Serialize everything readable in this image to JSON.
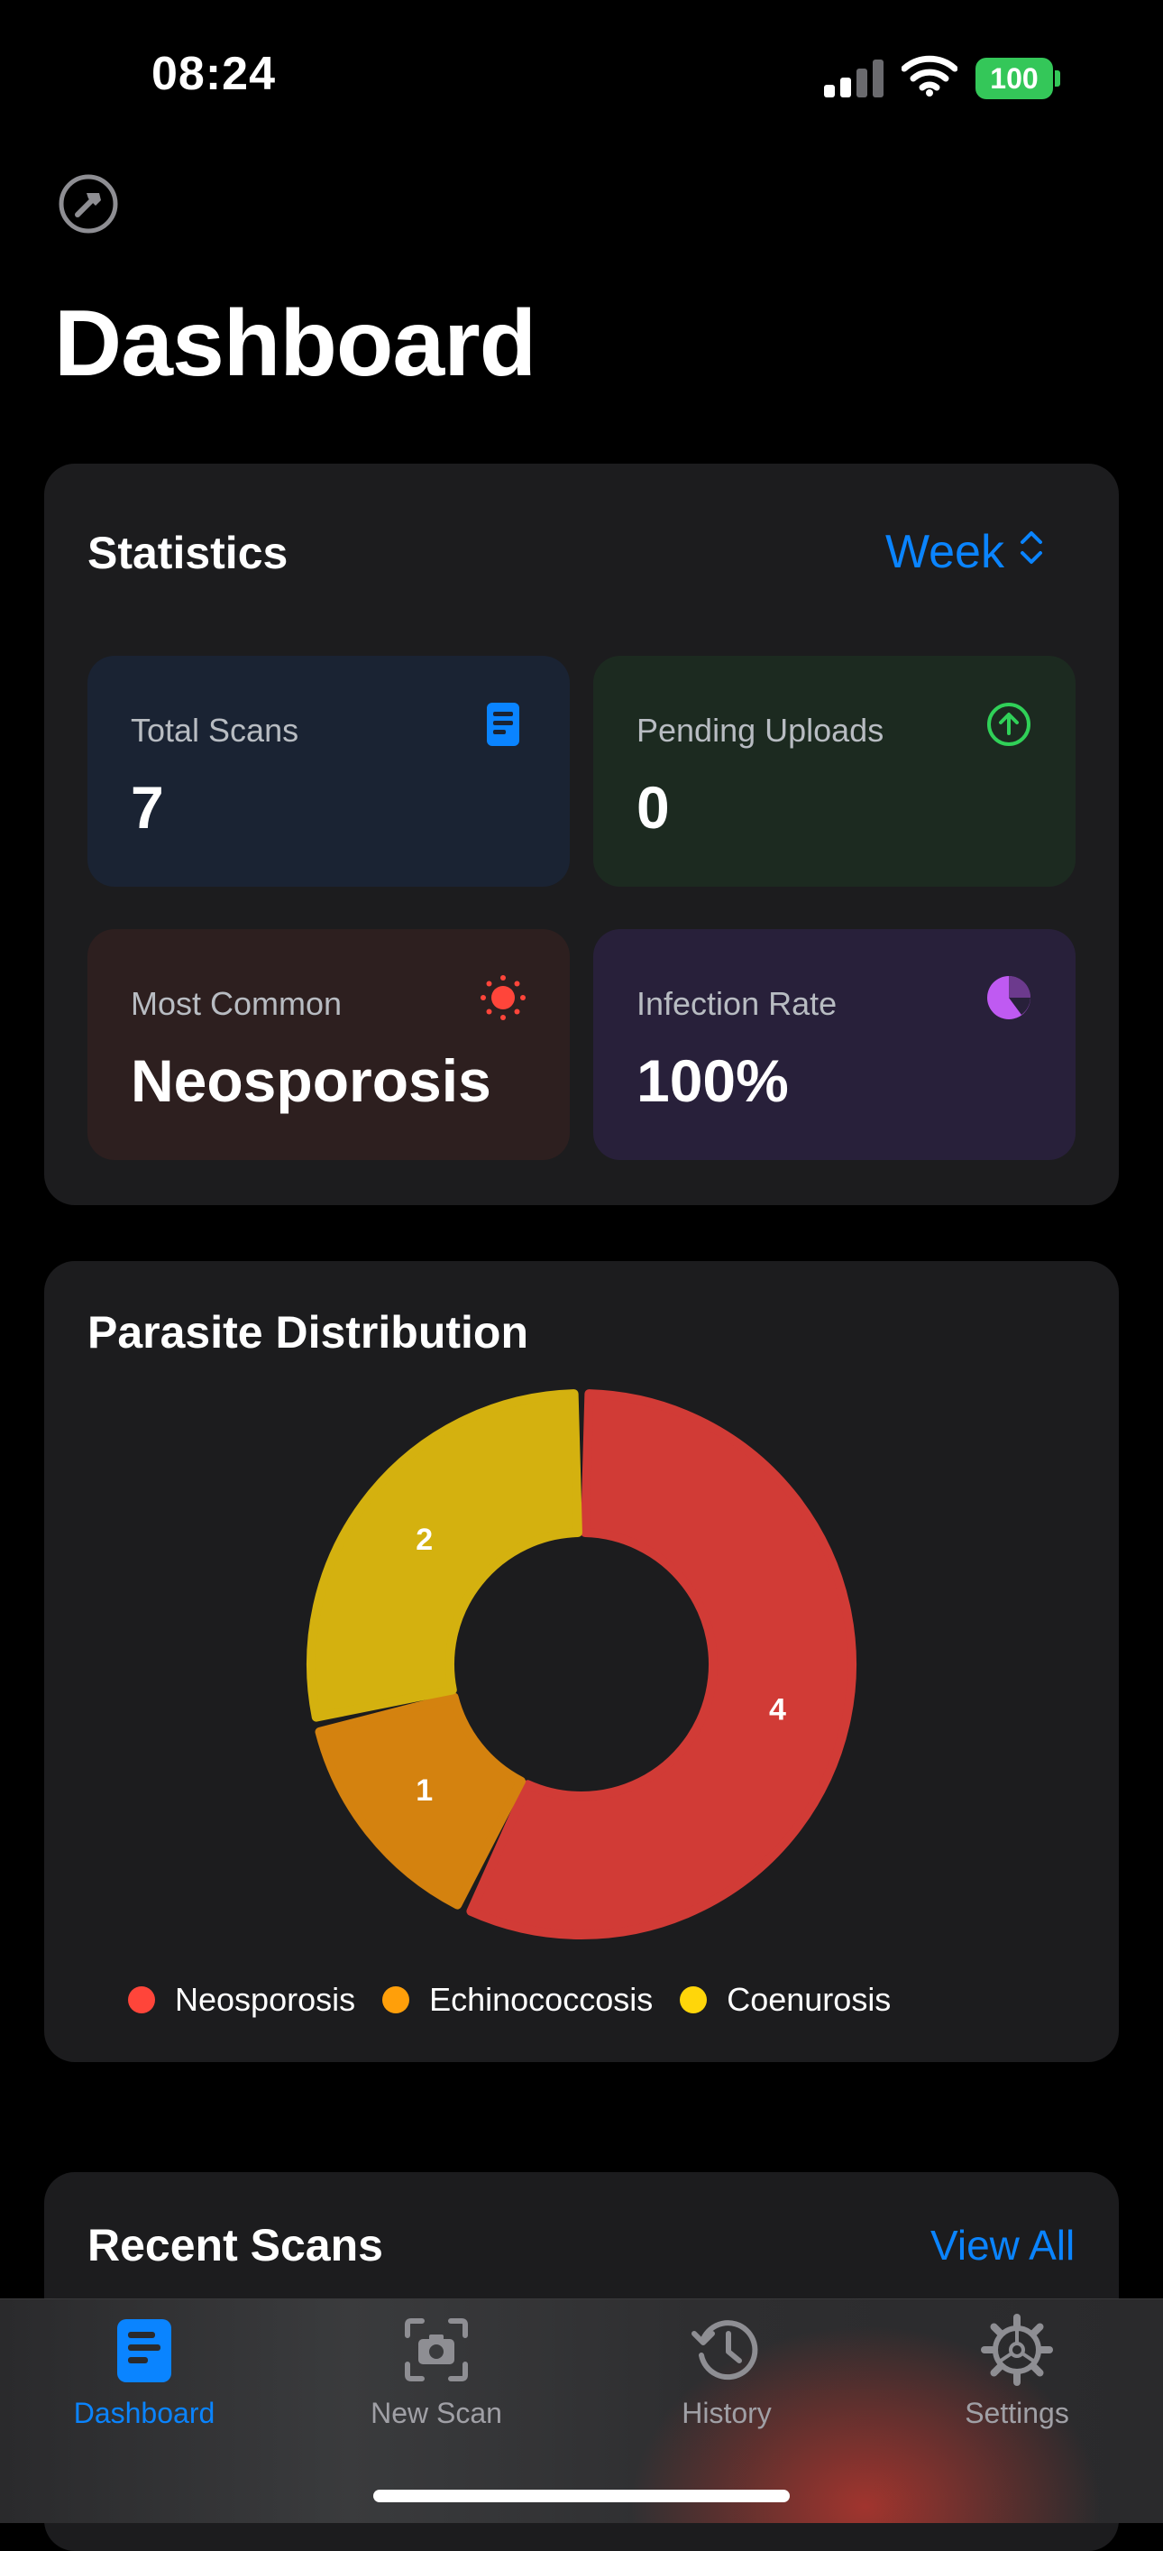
{
  "status_bar": {
    "time": "08:24",
    "battery": "100"
  },
  "header": {
    "title": "Dashboard"
  },
  "statistics": {
    "title": "Statistics",
    "period": "Week",
    "tiles": {
      "total_scans": {
        "label": "Total Scans",
        "value": "7"
      },
      "pending_uploads": {
        "label": "Pending Uploads",
        "value": "0"
      },
      "most_common": {
        "label": "Most Common",
        "value": "Neosporosis"
      },
      "infection_rate": {
        "label": "Infection Rate",
        "value": "100%"
      }
    },
    "colors": {
      "accent": "#0a84ff",
      "green": "#30d158",
      "red": "#ff453a",
      "purple": "#bf5af2"
    }
  },
  "distribution": {
    "title": "Parasite Distribution",
    "legend": [
      "Neosporosis",
      "Echinococcosis",
      "Coenurosis"
    ]
  },
  "chart_data": {
    "type": "pie",
    "categories": [
      "Neosporosis",
      "Echinococcosis",
      "Coenurosis"
    ],
    "values": [
      4,
      1,
      2
    ],
    "colors": [
      "#d13b36",
      "#d4820f",
      "#d4b10f"
    ],
    "data_labels": [
      "4",
      "1",
      "2"
    ],
    "title": "Parasite Distribution"
  },
  "recent": {
    "title": "Recent Scans",
    "view_all": "View All"
  },
  "tabbar": {
    "tabs": [
      {
        "label": "Dashboard",
        "icon": "dashboard-icon",
        "active": true
      },
      {
        "label": "New Scan",
        "icon": "camera-icon",
        "active": false
      },
      {
        "label": "History",
        "icon": "history-icon",
        "active": false
      },
      {
        "label": "Settings",
        "icon": "gear-icon",
        "active": false
      }
    ]
  }
}
